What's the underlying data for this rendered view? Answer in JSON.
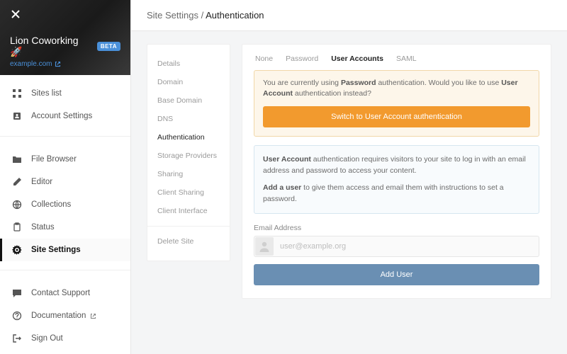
{
  "hero": {
    "title": "Lion Coworking 🚀",
    "badge": "BETA",
    "domain": "example.com"
  },
  "nav": {
    "sites_list": "Sites list",
    "account_settings": "Account Settings",
    "file_browser": "File Browser",
    "editor": "Editor",
    "collections": "Collections",
    "status": "Status",
    "site_settings": "Site Settings",
    "contact_support": "Contact Support",
    "documentation": "Documentation",
    "sign_out": "Sign Out"
  },
  "breadcrumb": {
    "a": "Site Settings",
    "b": "Authentication"
  },
  "subnav": {
    "details": "Details",
    "domain": "Domain",
    "base_domain": "Base Domain",
    "dns": "DNS",
    "authentication": "Authentication",
    "storage_providers": "Storage Providers",
    "sharing": "Sharing",
    "client_sharing": "Client Sharing",
    "client_interface": "Client Interface",
    "delete_site": "Delete Site"
  },
  "tabs": {
    "none": "None",
    "password": "Password",
    "user_accounts": "User Accounts",
    "saml": "SAML"
  },
  "notice": {
    "prefix": "You are currently using ",
    "b1": "Password",
    "mid": " authentication. Would you like to use ",
    "b2": "User Account",
    "suffix": " authentication instead?",
    "button": "Switch to User Account authentication"
  },
  "info": {
    "p1_b": "User Account",
    "p1_rest": " authentication requires visitors to your site to log in with an email address and password to access your content.",
    "p2_b": "Add a user",
    "p2_rest": " to give them access and email them with instructions to set a password."
  },
  "form": {
    "label": "Email Address",
    "placeholder": "user@example.org",
    "add_button": "Add User"
  }
}
